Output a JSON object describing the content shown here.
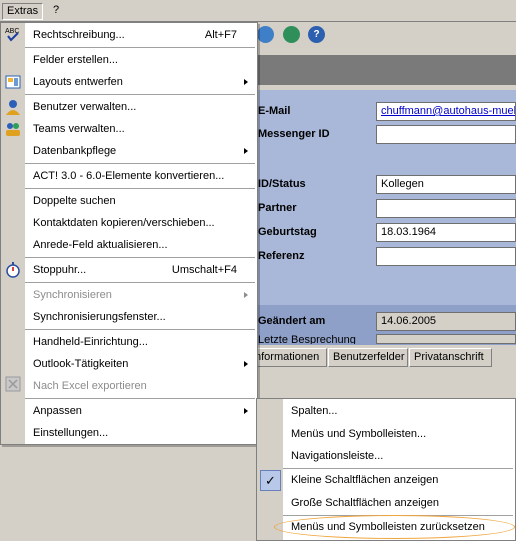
{
  "menubar": {
    "items": [
      {
        "label": "Extras",
        "active": true
      },
      {
        "label": "?"
      }
    ]
  },
  "toolbar": {
    "icons": [
      "globe-icon",
      "network-icon",
      "help-icon"
    ],
    "help_glyph": "?"
  },
  "form": {
    "fields": [
      {
        "label": "E-Mail",
        "value": "chuffmann@autohaus-mueller",
        "kind": "link"
      },
      {
        "label": "Messenger ID",
        "value": ""
      },
      {
        "label": "ID/Status",
        "value": "Kollegen"
      },
      {
        "label": "Partner",
        "value": ""
      },
      {
        "label": "Geburtstag",
        "value": "18.03.1964"
      },
      {
        "label": "Referenz",
        "value": ""
      },
      {
        "label": "Geändert am",
        "value": "14.06.2005",
        "kind": "readonly"
      },
      {
        "label": "Letzte Besprechung",
        "value": ""
      }
    ]
  },
  "tabs": [
    "nformationen",
    "Benutzerfelder",
    "Privatanschrift"
  ],
  "extras_menu": {
    "items": [
      {
        "label": "Rechtschreibung...",
        "shortcut": "Alt+F7",
        "icon": "spellcheck-icon"
      },
      {
        "label": "Felder erstellen..."
      },
      {
        "label": "Layouts entwerfen",
        "submenu": true,
        "icon": "layout-icon"
      },
      {
        "label": "Benutzer verwalten...",
        "icon": "user-icon"
      },
      {
        "label": "Teams verwalten...",
        "icon": "team-icon"
      },
      {
        "label": "Datenbankpflege",
        "submenu": true
      },
      {
        "label": "ACT! 3.0 - 6.0-Elemente konvertieren..."
      },
      {
        "label": "Doppelte suchen"
      },
      {
        "label": "Kontaktdaten kopieren/verschieben..."
      },
      {
        "label": "Anrede-Feld aktualisieren..."
      },
      {
        "label": "Stoppuhr...",
        "shortcut": "Umschalt+F4",
        "icon": "stopwatch-icon"
      },
      {
        "label": "Synchronisieren",
        "submenu": true,
        "disabled": true
      },
      {
        "label": "Synchronisierungsfenster..."
      },
      {
        "label": "Handheld-Einrichtung..."
      },
      {
        "label": "Outlook-Tätigkeiten",
        "submenu": true
      },
      {
        "label": "Nach Excel exportieren",
        "disabled": true,
        "icon": "excel-icon"
      },
      {
        "label": "Anpassen",
        "submenu": true
      },
      {
        "label": "Einstellungen..."
      }
    ]
  },
  "customize_submenu": {
    "items": [
      {
        "label": "Spalten..."
      },
      {
        "label": "Menüs und Symbolleisten..."
      },
      {
        "label": "Navigationsleiste..."
      },
      {
        "label": "Kleine Schaltflächen anzeigen",
        "checked": true
      },
      {
        "label": "Große Schaltflächen anzeigen"
      },
      {
        "label": "Menüs und Symbolleisten zurücksetzen",
        "highlighted": true
      }
    ],
    "check_glyph": "✓"
  },
  "colors": {
    "menu_gutter": "#d4d0c8",
    "form_bg": "#a9b8d9",
    "highlight_oval": "#f0a640",
    "link": "#0000cc"
  }
}
